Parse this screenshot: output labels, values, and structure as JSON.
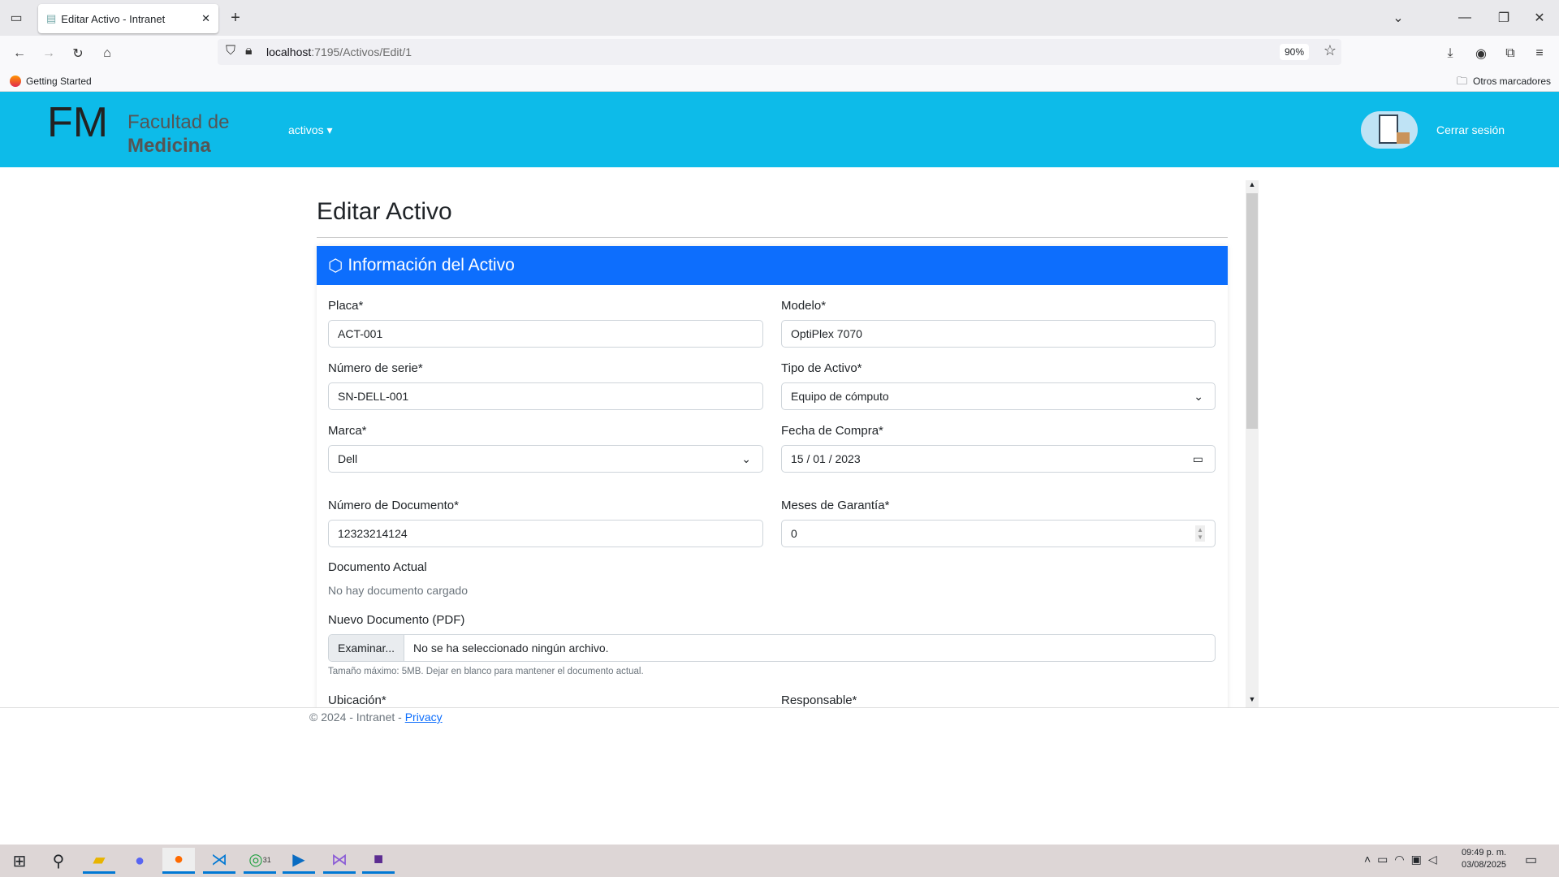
{
  "browser": {
    "tab_title": "Editar Activo - Intranet",
    "url_host": "localhost",
    "url_path": ":7195/Activos/Edit/1",
    "zoom": "90%",
    "bookmark": "Getting Started",
    "other_bookmarks": "Otros marcadores"
  },
  "header": {
    "logo_initials": "FM",
    "logo_line1": "Facultad de",
    "logo_line2": "Medicina",
    "nav_activos": "activos",
    "logout": "Cerrar sesión"
  },
  "page": {
    "title": "Editar Activo",
    "card_title": "Información del Activo"
  },
  "form": {
    "placa": {
      "label": "Placa*",
      "value": "ACT-001"
    },
    "modelo": {
      "label": "Modelo*",
      "value": "OptiPlex 7070"
    },
    "serie": {
      "label": "Número de serie*",
      "value": "SN-DELL-001"
    },
    "tipo": {
      "label": "Tipo de Activo*",
      "value": "Equipo de cómputo"
    },
    "marca": {
      "label": "Marca*",
      "value": "Dell"
    },
    "fecha": {
      "label": "Fecha de Compra*",
      "value": "15 / 01 / 2023"
    },
    "documento": {
      "label": "Número de Documento*",
      "value": "12323214124"
    },
    "garantia": {
      "label": "Meses de Garantía*",
      "value": "0"
    },
    "doc_actual": {
      "label": "Documento Actual",
      "value": "No hay documento cargado"
    },
    "nuevo_doc": {
      "label": "Nuevo Documento (PDF)",
      "button": "Examinar...",
      "value": "No se ha seleccionado ningún archivo.",
      "help": "Tamaño máximo: 5MB. Dejar en blanco para mantener el documento actual."
    },
    "ubicacion": {
      "label": "Ubicación*"
    },
    "responsable": {
      "label": "Responsable*"
    }
  },
  "footer": {
    "text": "© 2024 - Intranet - ",
    "privacy": "Privacy"
  },
  "taskbar": {
    "time": "09:49 p. m.",
    "date": "03/08/2025",
    "whatsapp_badge": "31"
  }
}
